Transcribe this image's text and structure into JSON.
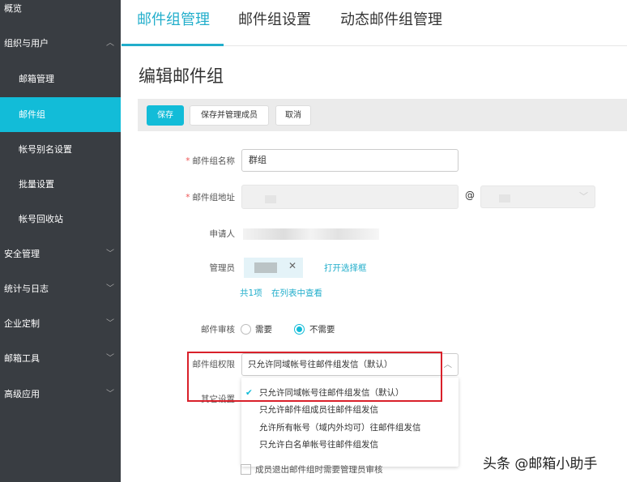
{
  "sidebar": {
    "items": [
      {
        "label": "概览",
        "chevron": ""
      },
      {
        "label": "组织与用户",
        "chevron": "^"
      },
      {
        "label": "邮箱管理",
        "chevron": ""
      },
      {
        "label": "邮件组",
        "chevron": ""
      },
      {
        "label": "帐号别名设置",
        "chevron": ""
      },
      {
        "label": "批量设置",
        "chevron": ""
      },
      {
        "label": "帐号回收站",
        "chevron": ""
      },
      {
        "label": "安全管理",
        "chevron": "v"
      },
      {
        "label": "统计与日志",
        "chevron": "v"
      },
      {
        "label": "企业定制",
        "chevron": "v"
      },
      {
        "label": "邮箱工具",
        "chevron": "v"
      },
      {
        "label": "高级应用",
        "chevron": "v"
      }
    ]
  },
  "tabs": [
    "邮件组管理",
    "邮件组设置",
    "动态邮件组管理"
  ],
  "page_title": "编辑邮件组",
  "toolbar": {
    "save": "保存",
    "save_manage": "保存并管理成员",
    "cancel": "取消"
  },
  "form": {
    "required_mark": "*",
    "name_label": "邮件组名称",
    "name_value": "群组",
    "address_label": "邮件组地址",
    "at": "@",
    "applicant_label": "申请人",
    "admin_label": "管理员",
    "admin_remove": "✕",
    "open_selector": "打开选择框",
    "count": "共1项",
    "view_in_list": "在列表中查看",
    "review_label": "邮件审核",
    "review_options": [
      "需要",
      "不需要"
    ],
    "permission_label": "邮件组权限",
    "permission_value": "只允许同域帐号往邮件组发信（默认）",
    "other_label": "其它设置",
    "permission_options": [
      "只允许同域帐号往邮件组发信（默认）",
      "只允许邮件组成员往邮件组发信",
      "允许所有帐号（域内外均可）往邮件组发信",
      "只允许白名单帐号往邮件组发信"
    ],
    "check_mark": "✔",
    "member_exit_review": "成员退出邮件组时需要管理员审核"
  },
  "watermark": "头条 @邮箱小助手",
  "colors": {
    "accent": "#12bcd8",
    "sidebar": "#393d42",
    "highlight": "#d9202a"
  }
}
